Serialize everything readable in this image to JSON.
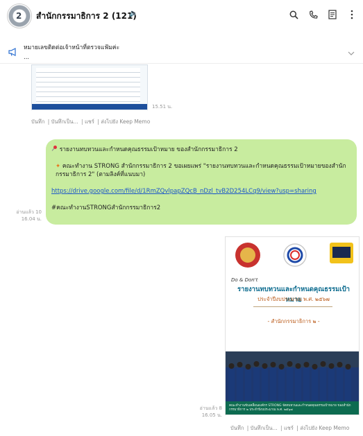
{
  "header": {
    "avatar_text": "2",
    "title": "สำนักกรรมาธิการ 2 (121)",
    "mute_glyph": "🔈",
    "icons": [
      "search-icon",
      "phone-icon",
      "notes-icon",
      "more-icon"
    ]
  },
  "announcement": {
    "text": "หมายเลขติดต่อเจ้าหน้าที่ตรวจแฟ้มค่ะ",
    "ellipsis": "..."
  },
  "message1": {
    "time": "15.51 น.",
    "actions": [
      "บันทึก",
      "บันทึกเป็น...",
      "แชร์",
      "ส่งไปยัง Keep Memo"
    ]
  },
  "message2": {
    "line1": "รายงานทบทวนและกำหนดคุณธรรมเป้าหมาย ของสำนักกรรมาธิการ 2",
    "line2": "คณะทำงาน STRONG สำนักกรรมาธิการ 2 ขอเผยแพร่ \"รายงานทบทวนและกำหนดคุณธรรมเป้าหมายของสำนักกรรมาธิการ 2\"  (ตามลิงค์ที่แนบมา)",
    "link": "https://drive.google.com/file/d/1RmZQvlpapZQcB_nDzl_tvB2D254LCq9/view?usp=sharing",
    "hashtag": "#คณะทำงานSTRONGสำนักกรรมาธิการ2",
    "read": "อ่านแล้ว 10",
    "time": "16.04 น."
  },
  "message3": {
    "poster_sub": "Do & Don't",
    "poster_title": "รายงานทบทวนและกำหนดคุณธรรมเป้าหมาย",
    "poster_sub2": "ประจำปีงบประมาณ พ.ศ. ๒๕๖๗",
    "poster_sub3": "- สำนักกรรมาธิการ ๒ -",
    "poster_band": "คณะทำงานขับเคลื่อนองค์กร STRONG จัดทบทวนและกำหนดคุณธรรมเป้าหมาย ของสำนักกรรมาธิการ ๒ ประจำปีงบประมาณ พ.ศ. ๒๕๖๗",
    "read": "อ่านแล้ว 8",
    "time": "16.05 น.",
    "actions": [
      "บันทึก",
      "บันทึกเป็น...",
      "แชร์",
      "ส่งไปยัง Keep Memo"
    ]
  },
  "colors": {
    "bubble": "#c8ec9f",
    "link": "#1a55c9",
    "poster_title": "#0c6b8e",
    "poster_band": "#0d6b50"
  }
}
